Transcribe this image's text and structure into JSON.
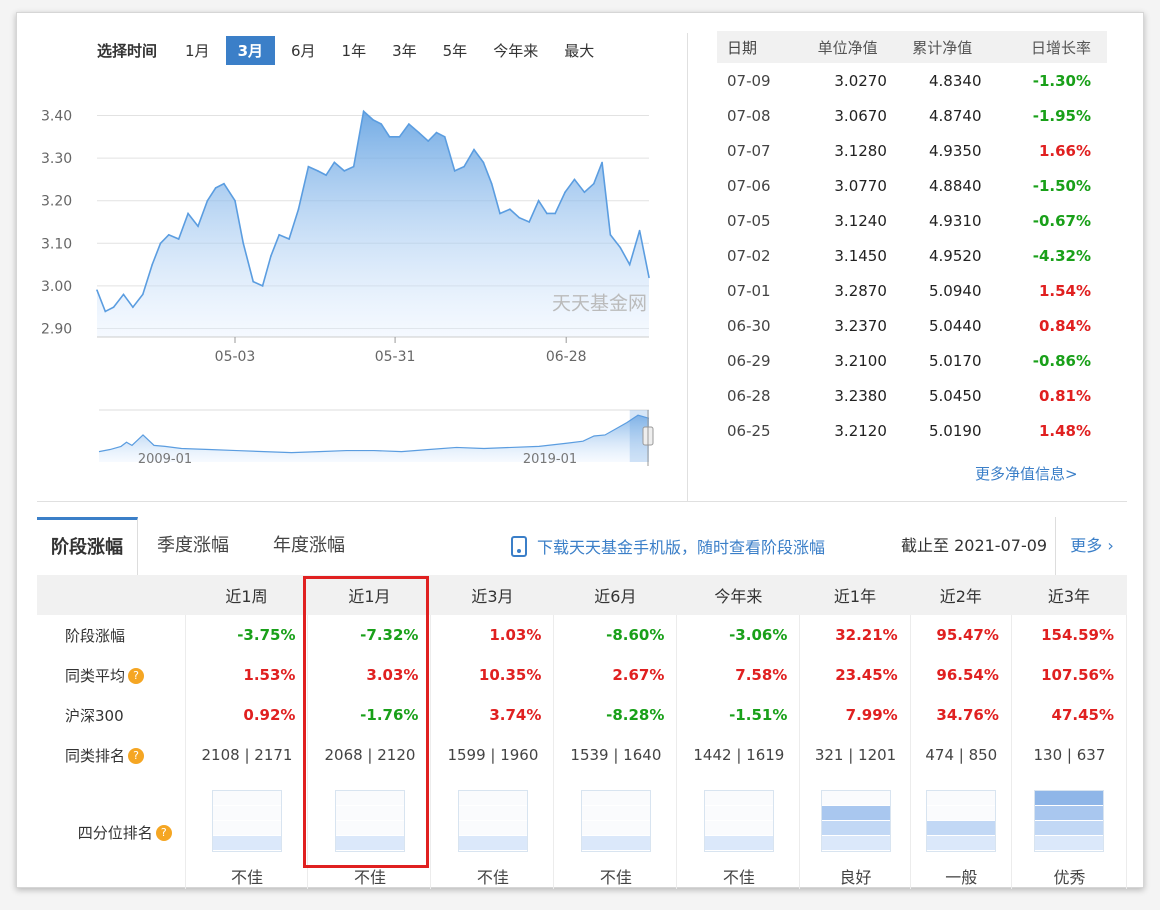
{
  "range_bar": {
    "label": "选择时间",
    "options": [
      "1月",
      "3月",
      "6月",
      "1年",
      "3年",
      "5年",
      "今年来",
      "最大"
    ],
    "active": "3月"
  },
  "chart_data": [
    {
      "type": "area",
      "watermark": "天天基金网",
      "yticks": [
        "3.40",
        "3.30",
        "3.20",
        "3.10",
        "3.00",
        "2.90"
      ],
      "ylim": [
        2.88,
        3.42
      ],
      "xticks": [
        {
          "label": "05-03",
          "x": 0.25
        },
        {
          "label": "05-31",
          "x": 0.54
        },
        {
          "label": "06-28",
          "x": 0.85
        }
      ],
      "x": [
        0,
        0.015,
        0.03,
        0.048,
        0.065,
        0.083,
        0.1,
        0.115,
        0.13,
        0.148,
        0.165,
        0.183,
        0.2,
        0.215,
        0.23,
        0.25,
        0.265,
        0.283,
        0.3,
        0.315,
        0.33,
        0.348,
        0.365,
        0.383,
        0.4,
        0.415,
        0.43,
        0.448,
        0.465,
        0.483,
        0.5,
        0.515,
        0.53,
        0.548,
        0.565,
        0.583,
        0.6,
        0.615,
        0.63,
        0.648,
        0.665,
        0.683,
        0.7,
        0.715,
        0.73,
        0.748,
        0.765,
        0.783,
        0.8,
        0.815,
        0.83,
        0.848,
        0.865,
        0.883,
        0.9,
        0.915,
        0.93,
        0.948,
        0.965,
        0.983,
        1.0
      ],
      "values": [
        2.99,
        2.94,
        2.95,
        2.98,
        2.95,
        2.98,
        3.05,
        3.1,
        3.12,
        3.11,
        3.17,
        3.14,
        3.2,
        3.23,
        3.24,
        3.2,
        3.1,
        3.01,
        3.0,
        3.07,
        3.12,
        3.11,
        3.18,
        3.28,
        3.27,
        3.26,
        3.29,
        3.27,
        3.28,
        3.41,
        3.39,
        3.38,
        3.35,
        3.35,
        3.38,
        3.36,
        3.34,
        3.36,
        3.35,
        3.27,
        3.28,
        3.32,
        3.29,
        3.24,
        3.17,
        3.18,
        3.16,
        3.15,
        3.2,
        3.17,
        3.17,
        3.22,
        3.25,
        3.22,
        3.24,
        3.29,
        3.12,
        3.09,
        3.05,
        3.13,
        3.02
      ],
      "color": "#5b9de0"
    },
    {
      "type": "area",
      "title": "navigator",
      "xticks": [
        {
          "label": "2009-01",
          "x": 0.12
        },
        {
          "label": "2019-01",
          "x": 0.82
        }
      ],
      "x": [
        0,
        0.02,
        0.04,
        0.05,
        0.06,
        0.07,
        0.08,
        0.1,
        0.12,
        0.15,
        0.2,
        0.25,
        0.3,
        0.35,
        0.4,
        0.45,
        0.5,
        0.55,
        0.6,
        0.65,
        0.7,
        0.75,
        0.8,
        0.85,
        0.88,
        0.9,
        0.92,
        0.94,
        0.96,
        0.98,
        1.0
      ],
      "values": [
        1.0,
        1.2,
        1.5,
        1.9,
        1.6,
        2.1,
        2.6,
        1.6,
        1.5,
        1.3,
        1.2,
        1.1,
        1.0,
        0.9,
        1.0,
        1.1,
        1.1,
        1.0,
        1.2,
        1.4,
        1.3,
        1.4,
        1.5,
        1.8,
        2.0,
        2.5,
        2.6,
        3.2,
        3.8,
        4.5,
        4.2
      ],
      "color": "#5b9de0"
    }
  ],
  "nav_table": {
    "headers": [
      "日期",
      "单位净值",
      "累计净值",
      "日增长率"
    ],
    "rows": [
      {
        "date": "07-09",
        "unit": "3.0270",
        "acc": "4.8340",
        "rate": "-1.30%",
        "dir": "down"
      },
      {
        "date": "07-08",
        "unit": "3.0670",
        "acc": "4.8740",
        "rate": "-1.95%",
        "dir": "down"
      },
      {
        "date": "07-07",
        "unit": "3.1280",
        "acc": "4.9350",
        "rate": "1.66%",
        "dir": "up"
      },
      {
        "date": "07-06",
        "unit": "3.0770",
        "acc": "4.8840",
        "rate": "-1.50%",
        "dir": "down"
      },
      {
        "date": "07-05",
        "unit": "3.1240",
        "acc": "4.9310",
        "rate": "-0.67%",
        "dir": "down"
      },
      {
        "date": "07-02",
        "unit": "3.1450",
        "acc": "4.9520",
        "rate": "-4.32%",
        "dir": "down"
      },
      {
        "date": "07-01",
        "unit": "3.2870",
        "acc": "5.0940",
        "rate": "1.54%",
        "dir": "up"
      },
      {
        "date": "06-30",
        "unit": "3.2370",
        "acc": "5.0440",
        "rate": "0.84%",
        "dir": "up"
      },
      {
        "date": "06-29",
        "unit": "3.2100",
        "acc": "5.0170",
        "rate": "-0.86%",
        "dir": "down"
      },
      {
        "date": "06-28",
        "unit": "3.2380",
        "acc": "5.0450",
        "rate": "0.81%",
        "dir": "up"
      },
      {
        "date": "06-25",
        "unit": "3.2120",
        "acc": "5.0190",
        "rate": "1.48%",
        "dir": "up"
      }
    ],
    "more_link": "更多净值信息>"
  },
  "tabs": {
    "items": [
      "阶段涨幅",
      "季度涨幅",
      "年度涨幅"
    ],
    "phone_note": "下载天天基金手机版，随时查看阶段涨幅",
    "as_of": "截止至 2021-07-09",
    "more": "更多"
  },
  "performance": {
    "periods": [
      "近1周",
      "近1月",
      "近3月",
      "近6月",
      "今年来",
      "近1年",
      "近2年",
      "近3年"
    ],
    "rows": [
      {
        "label": "阶段涨幅",
        "info": false,
        "values": [
          "-3.75%",
          "-7.32%",
          "1.03%",
          "-8.60%",
          "-3.06%",
          "32.21%",
          "95.47%",
          "154.59%"
        ],
        "dirs": [
          "down",
          "down",
          "up",
          "down",
          "down",
          "up",
          "up",
          "up"
        ]
      },
      {
        "label": "同类平均",
        "info": true,
        "values": [
          "1.53%",
          "3.03%",
          "10.35%",
          "2.67%",
          "7.58%",
          "23.45%",
          "96.54%",
          "107.56%"
        ],
        "dirs": [
          "up",
          "up",
          "up",
          "up",
          "up",
          "up",
          "up",
          "up"
        ]
      },
      {
        "label": "沪深300",
        "info": false,
        "values": [
          "0.92%",
          "-1.76%",
          "3.74%",
          "-8.28%",
          "-1.51%",
          "7.99%",
          "34.76%",
          "47.45%"
        ],
        "dirs": [
          "up",
          "down",
          "up",
          "down",
          "down",
          "up",
          "up",
          "up"
        ]
      }
    ],
    "rank_label": "同类排名",
    "ranks": [
      "2108 | 2171",
      "2068 | 2120",
      "1599 | 1960",
      "1539 | 1640",
      "1442 | 1619",
      "321 | 1201",
      "474 | 850",
      "130 | 637"
    ],
    "quartile_label": "四分位排名",
    "quartile_levels": [
      1,
      1,
      1,
      1,
      1,
      3,
      2,
      4
    ],
    "quartile_labels": [
      "不佳",
      "不佳",
      "不佳",
      "不佳",
      "不佳",
      "良好",
      "一般",
      "优秀"
    ]
  }
}
